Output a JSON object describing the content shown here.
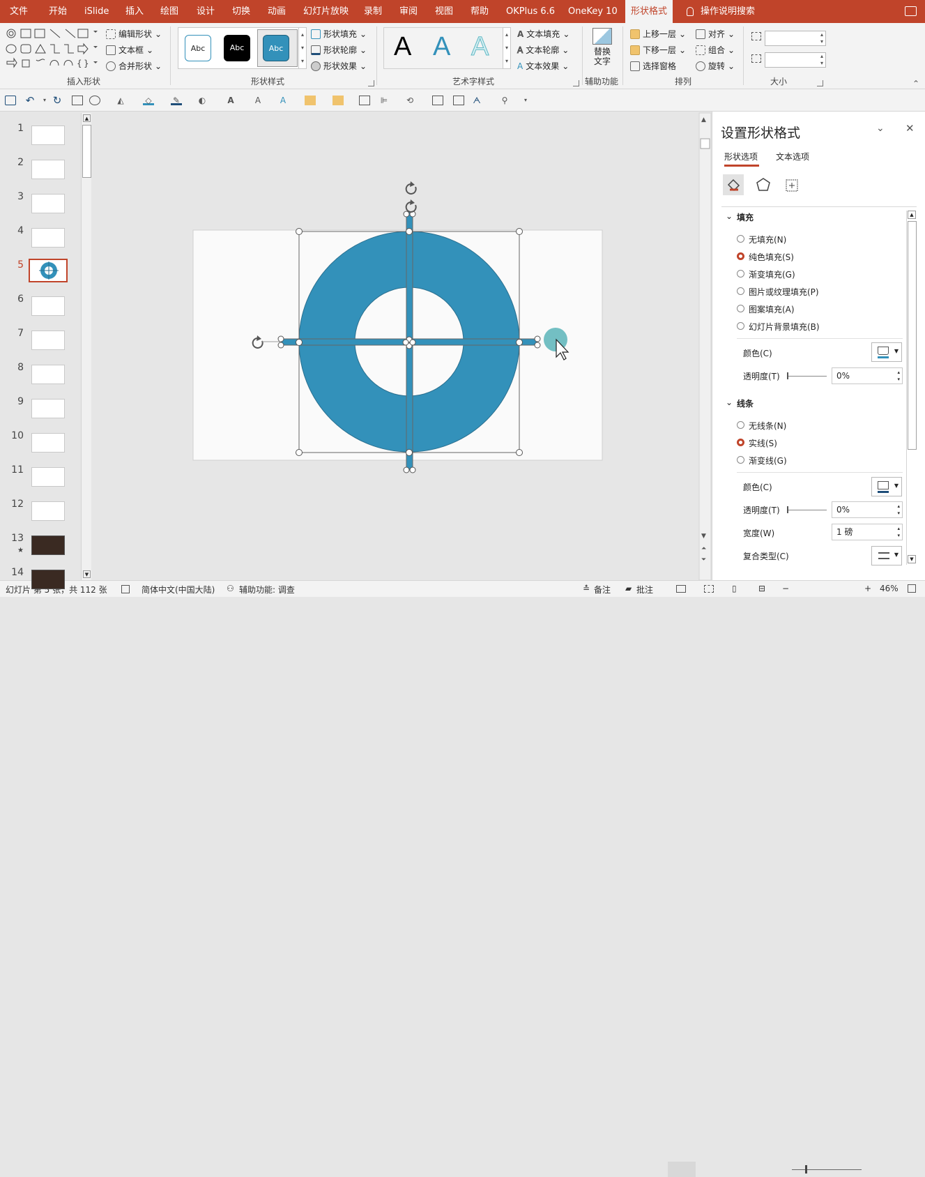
{
  "colors": {
    "accent": "#c0442a",
    "shape": "#3391ba",
    "shape_dark": "#2a6f8f",
    "bg": "#e6e6e6"
  },
  "menu": {
    "tabs": [
      "文件",
      "开始",
      "iSlide",
      "插入",
      "绘图",
      "设计",
      "切换",
      "动画",
      "幻灯片放映",
      "录制",
      "审阅",
      "视图",
      "帮助",
      "OKPlus 6.6",
      "OneKey 10",
      "形状格式",
      "操作说明搜索"
    ]
  },
  "ribbon": {
    "insert_shape": {
      "edit_shape": "编辑形状",
      "text_box": "文本框",
      "merge_shapes": "合并形状",
      "label": "插入形状"
    },
    "shape_styles": {
      "sample": "Abc",
      "fill": "形状填充",
      "outline": "形状轮廓",
      "effect": "形状效果",
      "label": "形状样式"
    },
    "wordart": {
      "sample": "A",
      "fill": "文本填充",
      "outline": "文本轮廓",
      "effect": "文本效果",
      "label": "艺术字样式"
    },
    "accessibility": {
      "alt_text_line1": "替换",
      "alt_text_line2": "文字",
      "label": "辅助功能"
    },
    "arrange": {
      "bring_forward": "上移一层",
      "send_backward": "下移一层",
      "selection_pane": "选择窗格",
      "align": "对齐",
      "group": "组合",
      "rotate": "旋转",
      "label": "排列"
    },
    "size": {
      "label": "大小",
      "height": "",
      "width": ""
    }
  },
  "thumbnails": [
    {
      "num": "1",
      "star": ""
    },
    {
      "num": "2",
      "star": ""
    },
    {
      "num": "3",
      "star": ""
    },
    {
      "num": "4",
      "star": ""
    },
    {
      "num": "5",
      "star": ""
    },
    {
      "num": "6",
      "star": ""
    },
    {
      "num": "7",
      "star": ""
    },
    {
      "num": "8",
      "star": ""
    },
    {
      "num": "9",
      "star": ""
    },
    {
      "num": "10",
      "star": ""
    },
    {
      "num": "11",
      "star": ""
    },
    {
      "num": "12",
      "star": ""
    },
    {
      "num": "13",
      "star": "★"
    },
    {
      "num": "14",
      "star": ""
    }
  ],
  "pane": {
    "title": "设置形状格式",
    "tab_shape": "形状选项",
    "tab_text": "文本选项",
    "fill": {
      "header": "填充",
      "options": [
        "无填充(N)",
        "纯色填充(S)",
        "渐变填充(G)",
        "图片或纹理填充(P)",
        "图案填充(A)",
        "幻灯片背景填充(B)"
      ],
      "selected": 1,
      "color_label": "颜色(C)",
      "transparency_label": "透明度(T)",
      "transparency_value": "0%"
    },
    "line": {
      "header": "线条",
      "options": [
        "无线条(N)",
        "实线(S)",
        "渐变线(G)"
      ],
      "selected": 1,
      "color_label": "颜色(C)",
      "transparency_label": "透明度(T)",
      "transparency_value": "0%",
      "width_label": "宽度(W)",
      "width_value": "1 磅",
      "compound_label": "复合类型(C)"
    }
  },
  "status": {
    "slide_info": "幻灯片 第 5 张，共 112 张",
    "language": "简体中文(中国大陆)",
    "accessibility": "辅助功能: 调查",
    "notes": "备注",
    "comments": "批注",
    "zoom": "46%"
  }
}
